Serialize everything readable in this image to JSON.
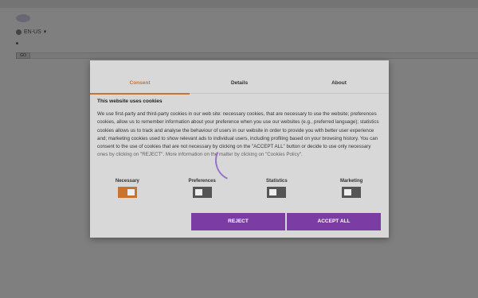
{
  "background": {
    "language_label": "EN-US",
    "search_button": "GO"
  },
  "dialog": {
    "tabs": [
      {
        "label": "Consent",
        "active": true
      },
      {
        "label": "Details",
        "active": false
      },
      {
        "label": "About",
        "active": false
      }
    ],
    "heading": "This website uses cookies",
    "body": "We use first-party and third-party cookies in our web site: necessary cookies, that are necessary to use the website; preferences cookies, allow us to remember information about your preference when you use our websites (e.g., preferred language); statistics cookies allows us to track and analyse the behaviour of users in our website in order to provide you with better user experience and; marketing cookies used to show relevant ads to individual users, including profiling based on your browsing history. You can consent to the use of cookies that are not necessary by clicking on the \"ACCEPT ALL\" button or decide to use only necessary ones by clicking on \"REJECT\". More information on the matter by clicking on \"Cookies Policy\".",
    "toggles": [
      {
        "label": "Necessary",
        "state": "on"
      },
      {
        "label": "Preferences",
        "state": "off"
      },
      {
        "label": "Statistics",
        "state": "off"
      },
      {
        "label": "Marketing",
        "state": "off"
      }
    ],
    "reject_label": "REJECT",
    "accept_label": "ACCEPT ALL"
  },
  "colors": {
    "accent_orange": "#c9742e",
    "button_purple": "#7b3ca4",
    "overlay": "rgba(0,0,0,0.5)"
  }
}
